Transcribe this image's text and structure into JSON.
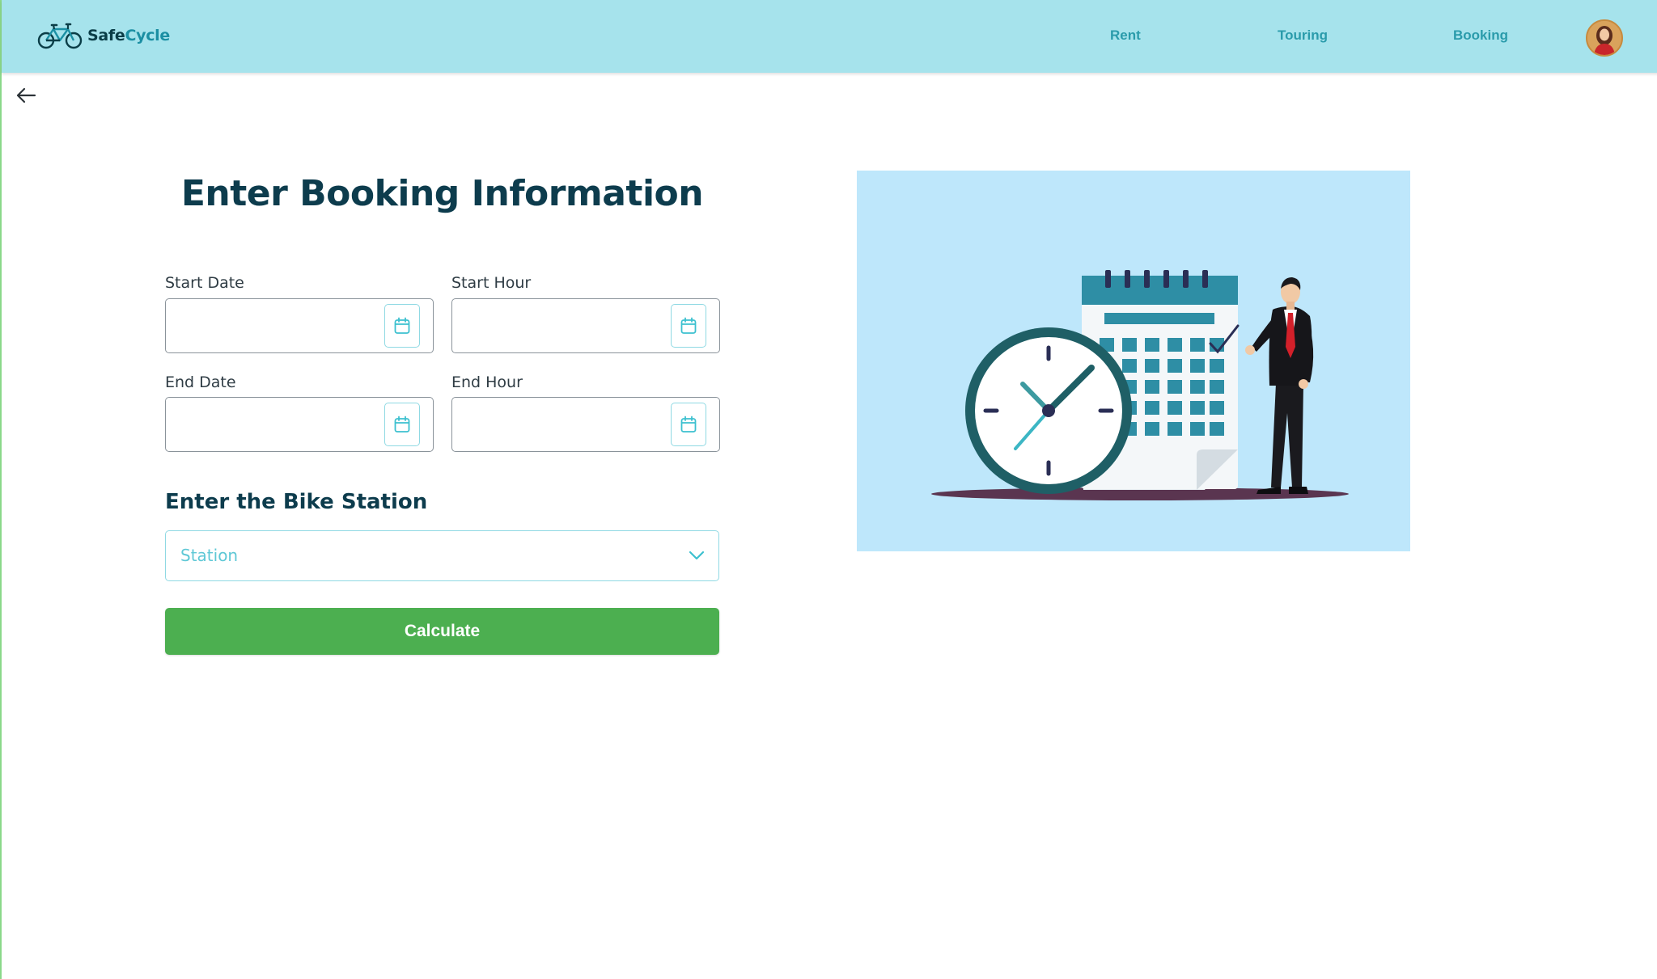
{
  "header": {
    "logo": {
      "part1": "Safe",
      "part2": "Cycle"
    },
    "nav": [
      "Rent",
      "Touring",
      "Booking"
    ]
  },
  "form": {
    "title": "Enter Booking Information",
    "start_date_label": "Start Date",
    "start_hour_label": "Start Hour",
    "end_date_label": "End Date",
    "end_hour_label": "End Hour",
    "start_date_value": "",
    "start_hour_value": "",
    "end_date_value": "",
    "end_hour_value": "",
    "station_section_title": "Enter the Bike Station",
    "station_placeholder": "Station",
    "calculate_label": "Calculate"
  },
  "colors": {
    "header_bg": "#a6e3ec",
    "nav_link": "#2a9bab",
    "title": "#0d3c4d",
    "accent": "#5fc8d6",
    "button": "#4caf50",
    "illustration_bg": "#bee7fb"
  },
  "icons": {
    "logo": "bicycle-icon",
    "back": "arrow-left-icon",
    "date_picker": "calendar-icon",
    "dropdown": "chevron-down-icon"
  }
}
